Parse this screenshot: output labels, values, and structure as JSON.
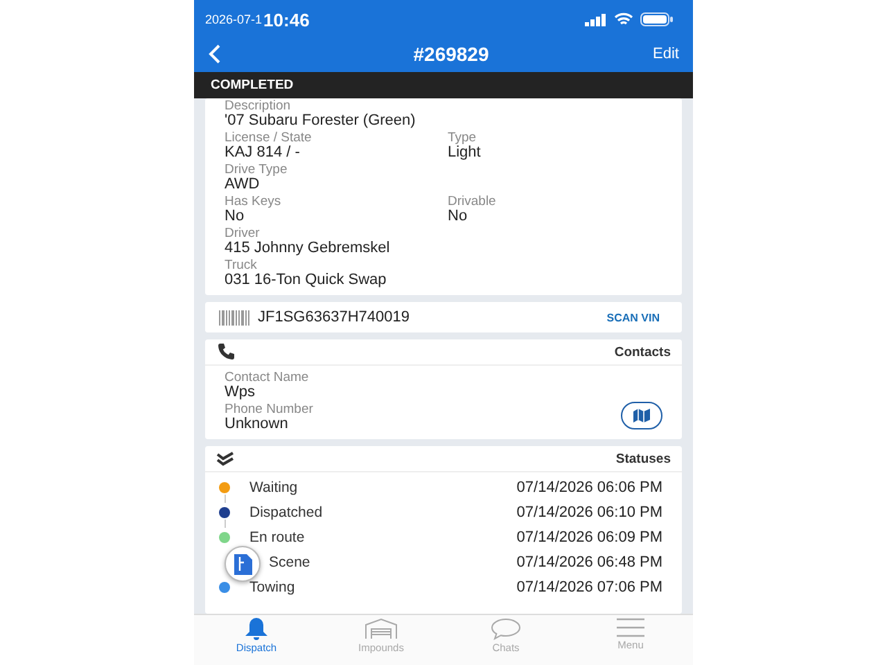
{
  "status_bar": {
    "date_stamp": "2026-07-1",
    "time": "10:46"
  },
  "header": {
    "title": "#269829",
    "action": "Edit"
  },
  "status_banner": "COMPLETED",
  "vehicle": {
    "rows": [
      [
        {
          "label": "Description",
          "value": "'07 Subaru Forester (Green)"
        }
      ],
      [
        {
          "label": "License / State",
          "value": "KAJ 814 / -"
        },
        {
          "label": "Type",
          "value": "Light"
        }
      ],
      [
        {
          "label": "Drive Type",
          "value": "AWD"
        }
      ],
      [
        {
          "label": "Has Keys",
          "value": "No"
        },
        {
          "label": "Drivable",
          "value": "No"
        }
      ],
      [
        {
          "label": "Driver",
          "value": "415 Johnny Gebremskel"
        }
      ],
      [
        {
          "label": "Truck",
          "value": "031 16-Ton Quick Swap"
        }
      ]
    ]
  },
  "vin": {
    "value": "JF1SG63637H740019",
    "action": "SCAN VIN"
  },
  "contacts": {
    "title": "Contacts",
    "fields": [
      {
        "label": "Contact Name",
        "value": "Wps"
      },
      {
        "label": "Phone Number",
        "value": "Unknown"
      }
    ]
  },
  "statuses": {
    "title": "Statuses",
    "items": [
      {
        "label": "Waiting",
        "time": "07/14/2026 06:06 PM",
        "color": "#f39c12"
      },
      {
        "label": "Dispatched",
        "time": "07/14/2026 06:10 PM",
        "color": "#1f3f8f"
      },
      {
        "label": "En route",
        "time": "07/14/2026 06:09 PM",
        "color": "#7fd68a"
      },
      {
        "label": "Scene",
        "time": "07/14/2026 06:48 PM"
      },
      {
        "label": "Towing",
        "time": "07/14/2026 07:06 PM",
        "color": "#3a8ee6"
      }
    ]
  },
  "nav": [
    {
      "label": "Dispatch",
      "selected": true
    },
    {
      "label": "Impounds",
      "selected": false
    },
    {
      "label": "Chats",
      "selected": false
    },
    {
      "label": "Menu",
      "selected": false
    }
  ]
}
